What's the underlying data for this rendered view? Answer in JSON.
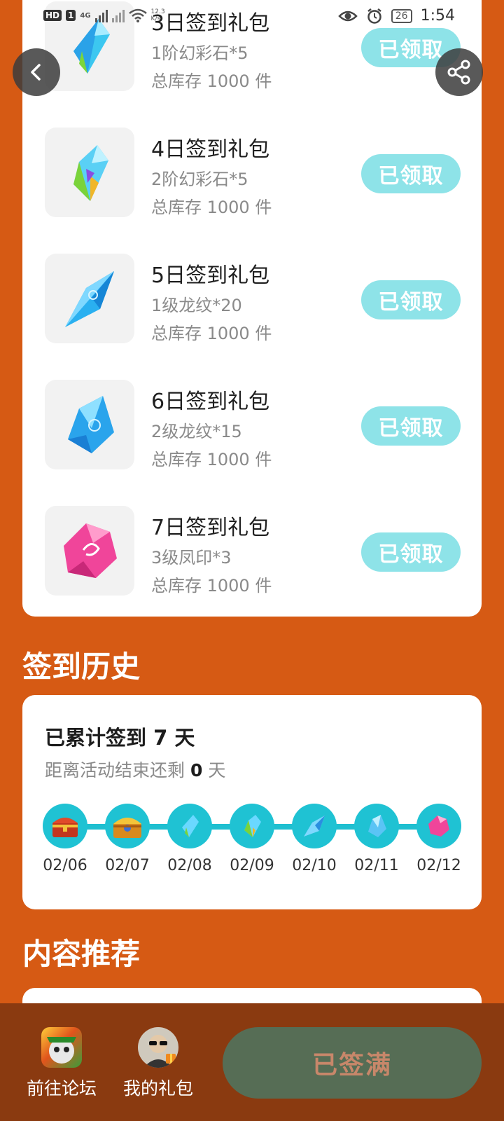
{
  "status_bar": {
    "hd": "HD",
    "sim": "1",
    "net": "4G",
    "speed_value": "12.3",
    "speed_unit": "K/s",
    "battery": "26",
    "time": "1:54"
  },
  "nav": {
    "back_icon": "chevron-left-icon",
    "share_icon": "share-icon"
  },
  "gifts": [
    {
      "title": "3日签到礼包",
      "item": "1阶幻彩石*5",
      "stock": "总库存 1000 件",
      "button": "已领取",
      "icon": "gem-rainbow-1"
    },
    {
      "title": "4日签到礼包",
      "item": "2阶幻彩石*5",
      "stock": "总库存 1000 件",
      "button": "已领取",
      "icon": "gem-rainbow-2"
    },
    {
      "title": "5日签到礼包",
      "item": "1级龙纹*20",
      "stock": "总库存 1000 件",
      "button": "已领取",
      "icon": "dragon-crystal-1"
    },
    {
      "title": "6日签到礼包",
      "item": "2级龙纹*15",
      "stock": "总库存 1000 件",
      "button": "已领取",
      "icon": "dragon-crystal-2"
    },
    {
      "title": "7日签到礼包",
      "item": "3级凤印*3",
      "stock": "总库存 1000 件",
      "button": "已领取",
      "icon": "phoenix-gem"
    }
  ],
  "history": {
    "section_title": "签到历史",
    "total_prefix": "已累计签到",
    "total_days": "7",
    "total_suffix": "天",
    "remain_prefix": "距离活动结束还剩",
    "remain_days": "0",
    "remain_suffix": "天",
    "dates": [
      "02/06",
      "02/07",
      "02/08",
      "02/09",
      "02/10",
      "02/11",
      "02/12"
    ]
  },
  "recommend": {
    "section_title": "内容推荐"
  },
  "bottom_bar": {
    "forum_label": "前往论坛",
    "my_gifts_label": "我的礼包",
    "signed_button": "已签满"
  },
  "colors": {
    "background": "#d65a14",
    "claimed_button": "#8ee3e8",
    "timeline": "#1fc2d3",
    "bottom_bar": "#8a3a10",
    "signed_button": "#566d55",
    "signed_text": "#c8876a"
  }
}
